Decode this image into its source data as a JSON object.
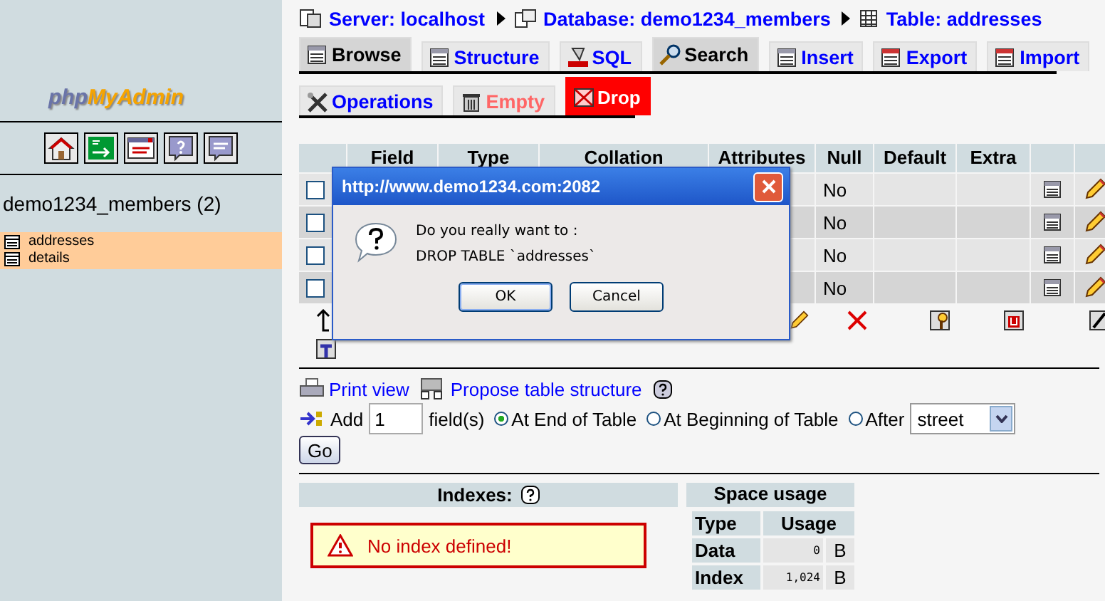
{
  "sidebar": {
    "logo_part_1": "php",
    "logo_part_2": "MyAdmin",
    "database": "demo1234_members (2)",
    "tables": [
      {
        "name": "addresses"
      },
      {
        "name": "details"
      }
    ]
  },
  "breadcrumb": [
    "Server: localhost",
    "Database: demo1234_members",
    "Table: addresses"
  ],
  "tab_rows": [
    [
      {
        "label": "Browse",
        "kind": "browse",
        "shaded": true,
        "danger": false,
        "selected": false
      },
      {
        "label": "Structure",
        "kind": "structure",
        "shaded": false,
        "danger": false,
        "selected": false
      },
      {
        "label": "SQL",
        "kind": "sql",
        "shaded": false,
        "danger": false,
        "selected": false
      },
      {
        "label": "Search",
        "kind": "search",
        "shaded": true,
        "danger": false,
        "selected": false
      },
      {
        "label": "Insert",
        "kind": "insert",
        "shaded": false,
        "danger": false,
        "selected": false
      },
      {
        "label": "Export",
        "kind": "export",
        "shaded": false,
        "danger": false,
        "selected": false
      },
      {
        "label": "Import",
        "kind": "import",
        "shaded": false,
        "danger": false,
        "selected": false
      }
    ],
    [
      {
        "label": "Operations",
        "kind": "operations",
        "shaded": false,
        "danger": false,
        "selected": false
      },
      {
        "label": "Empty",
        "kind": "empty",
        "shaded": false,
        "danger": true,
        "selected": false
      },
      {
        "label": "Drop",
        "kind": "drop",
        "shaded": false,
        "danger": true,
        "selected": true
      }
    ]
  ],
  "table": {
    "columns": [
      "Field",
      "Type",
      "Collation",
      "Attributes",
      "Null",
      "Default",
      "Extra"
    ],
    "rows": [
      {
        "checked": false,
        "null": "No"
      },
      {
        "checked": false,
        "null": "No"
      },
      {
        "checked": false,
        "null": "No"
      },
      {
        "checked": false,
        "null": "No"
      }
    ]
  },
  "dialog": {
    "title": "http://www.demo1234.com:2082",
    "lines": [
      "Do you really want to :",
      "DROP TABLE `addresses`"
    ],
    "buttons": [
      "OK",
      "Cancel"
    ]
  },
  "links": [
    "Print view",
    "Propose table structure"
  ],
  "add_fields": {
    "label": "Add",
    "count": "1",
    "unit": "field(s)",
    "positions": [
      {
        "label": "At End of Table",
        "selected": true
      },
      {
        "label": "At Beginning of Table",
        "selected": false
      },
      {
        "label": "After",
        "selected": false
      }
    ],
    "after_field": "street",
    "go": "Go"
  },
  "indexes": {
    "title": "Indexes:",
    "message": "No index defined!"
  },
  "space_usage": {
    "title": "Space usage",
    "columns": [
      "Type",
      "Usage"
    ],
    "rows": [
      [
        "Data",
        "0",
        "B"
      ],
      [
        "Index",
        "1,024",
        "B"
      ]
    ]
  }
}
